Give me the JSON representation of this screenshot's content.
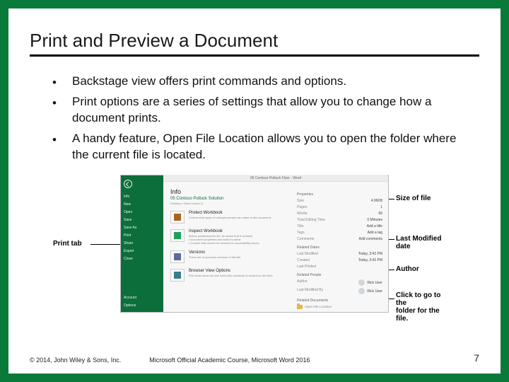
{
  "title": "Print and Preview a Document",
  "bullets": [
    "Backstage view offers print commands and options.",
    "Print options are a series of settings that allow you to change how a document prints.",
    "A handy feature, Open File Location allows you to open the folder where the current file is located."
  ],
  "figure": {
    "window_title": "05 Contoso Potluck Flyer - Word",
    "sidebar": [
      "Info",
      "New",
      "Open",
      "Save",
      "Save As",
      "Print",
      "Share",
      "Export",
      "Close",
      "Account",
      "Options"
    ],
    "info": {
      "heading": "Info",
      "doc_title": "05 Contoso Potluck Solution",
      "path": "Desktop » Word Lesson 5",
      "blocks": [
        {
          "title": "Protect Workbook",
          "desc": "Control what types of changes people can make to this document.",
          "icon": "#a8641e"
        },
        {
          "title": "Inspect Workbook",
          "desc": "Before publishing this file, be aware that it contains:\n• Document properties and author's name\n• Content that cannot be checked for accessibility issues",
          "icon": "#1fa05a"
        },
        {
          "title": "Versions",
          "desc": "There are no previous versions of this file.",
          "icon": "#5b6aa0"
        },
        {
          "title": "Browser View Options",
          "desc": "Pick what users can see when this workbook is viewed on the Web.",
          "icon": "#3a7c8c"
        }
      ]
    },
    "properties": {
      "section_props": "Properties",
      "size": {
        "k": "Size",
        "v": "4.06KB"
      },
      "pages": {
        "k": "Pages",
        "v": "1"
      },
      "words": {
        "k": "Words",
        "v": "66"
      },
      "editing": {
        "k": "Total Editing Time",
        "v": "0 Minutes"
      },
      "title": {
        "k": "Title",
        "v": "Add a title"
      },
      "tags": {
        "k": "Tags",
        "v": "Add a tag"
      },
      "comments": {
        "k": "Comments",
        "v": "Add comments"
      },
      "section_dates": "Related Dates",
      "modified": {
        "k": "Last Modified",
        "v": "Today, 3:42 PM"
      },
      "created": {
        "k": "Created",
        "v": "Today, 3:42 PM"
      },
      "printed": {
        "k": "Last Printed",
        "v": ""
      },
      "section_people": "Related People",
      "author": {
        "k": "Author",
        "v": "Rick User"
      },
      "lastmod_by": {
        "k": "Last Modified By",
        "v": "Rick User"
      },
      "section_docs": "Related Documents",
      "open_loc": "Open File Location"
    }
  },
  "callouts": {
    "print_tab": "Print tab",
    "size": "Size of file",
    "last_modified": "Last Modified date",
    "author": "Author",
    "open": "Click to go to the\nfolder for the file."
  },
  "footer": {
    "left": "© 2014, John Wiley & Sons, Inc.",
    "center": "Microsoft Official Academic Course, Microsoft Word 2016",
    "right": "7"
  }
}
